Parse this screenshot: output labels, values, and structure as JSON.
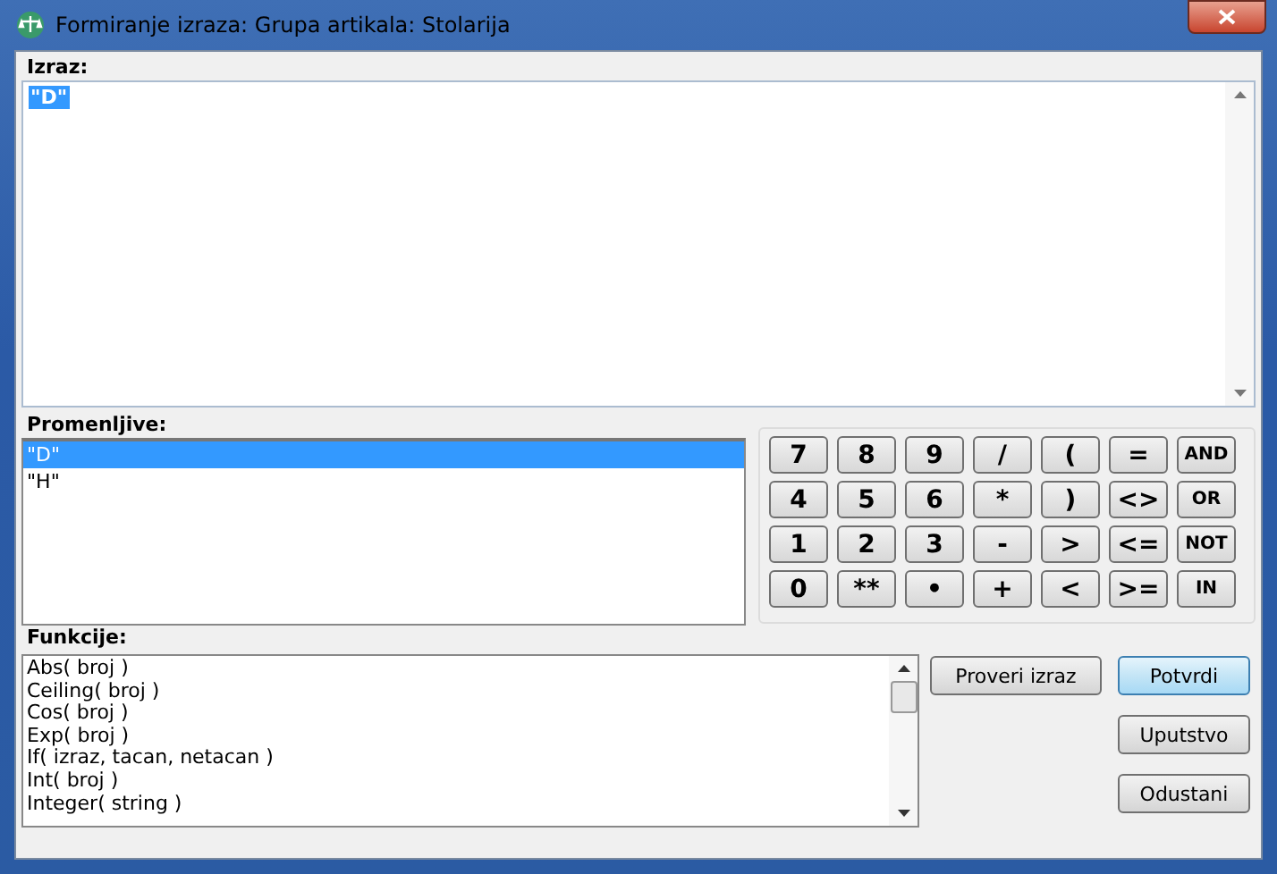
{
  "window": {
    "title": "Formiranje izraza: Grupa artikala: Stolarija"
  },
  "expression": {
    "label": "Izraz:",
    "text": "\"D\"",
    "selected": true
  },
  "variables": {
    "label": "Promenljive:",
    "items": [
      {
        "text": "\"D\"",
        "selected": true
      },
      {
        "text": "\"H\"",
        "selected": false
      }
    ]
  },
  "keypad": [
    [
      "7",
      "8",
      "9",
      "/",
      "(",
      "=",
      "AND"
    ],
    [
      "4",
      "5",
      "6",
      "*",
      ")",
      "<>",
      "OR"
    ],
    [
      "1",
      "2",
      "3",
      "-",
      ">",
      "<=",
      "NOT"
    ],
    [
      "0",
      "**",
      "•",
      "+",
      "<",
      ">=",
      "IN"
    ]
  ],
  "functions": {
    "label": "Funkcije:",
    "items": [
      "Abs( broj )",
      "Ceiling( broj )",
      "Cos( broj )",
      "Exp( broj )",
      "If( izraz, tacan, netacan )",
      "Int( broj )",
      "Integer( string )"
    ]
  },
  "buttons": [
    {
      "label": "Proveri izraz",
      "kind": "plain"
    },
    {
      "label": "Potvrdi",
      "kind": "default"
    },
    {
      "label": "Uputstvo",
      "kind": "plain"
    },
    {
      "label": "Odustani",
      "kind": "plain"
    }
  ]
}
